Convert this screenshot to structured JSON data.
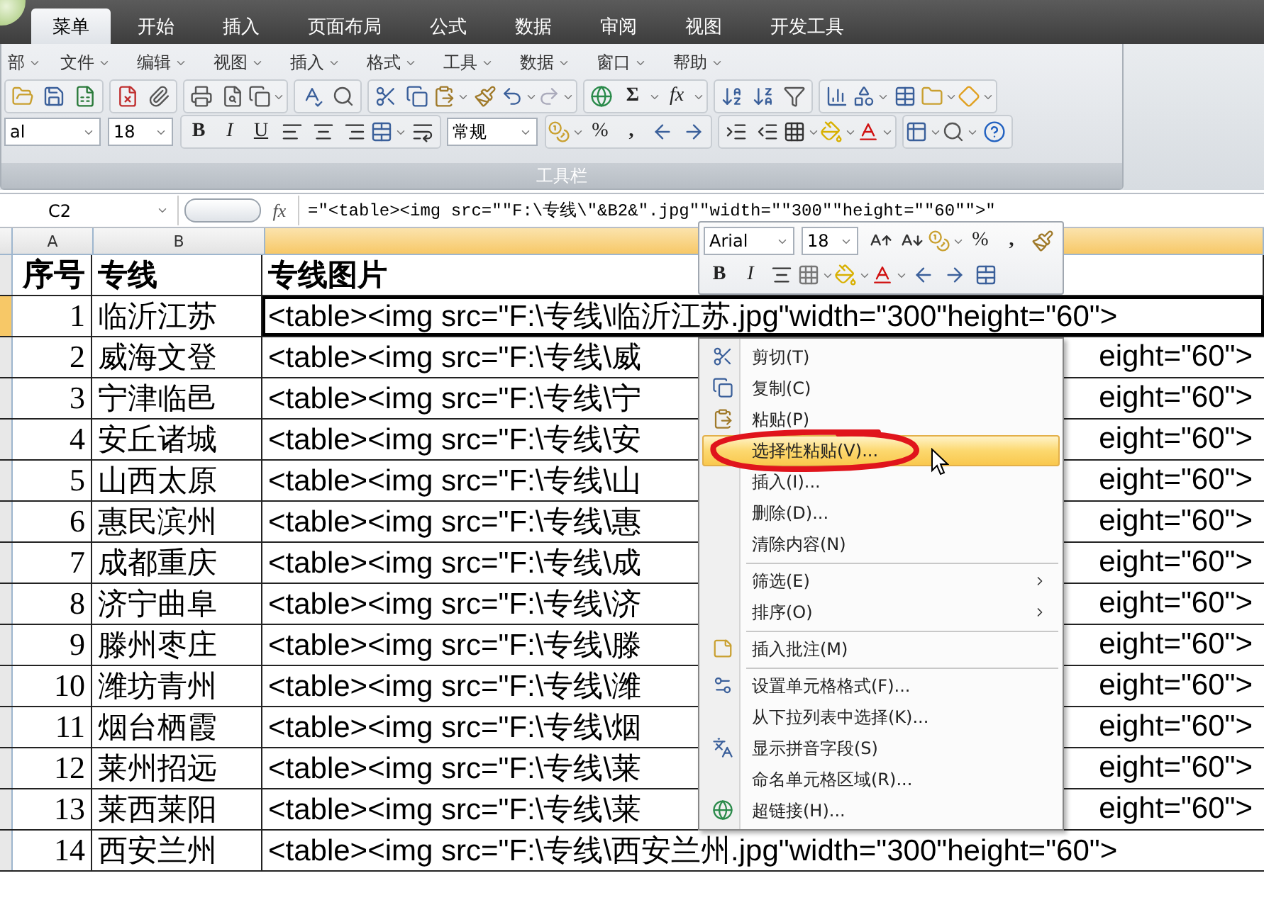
{
  "tabs": [
    {
      "label": "菜单",
      "selected": true
    },
    {
      "label": "开始",
      "selected": false
    },
    {
      "label": "插入",
      "selected": false
    },
    {
      "label": "页面布局",
      "selected": false
    },
    {
      "label": "公式",
      "selected": false
    },
    {
      "label": "数据",
      "selected": false
    },
    {
      "label": "审阅",
      "selected": false
    },
    {
      "label": "视图",
      "selected": false
    },
    {
      "label": "开发工具",
      "selected": false
    }
  ],
  "menu_bar": [
    "部",
    "文件",
    "编辑",
    "视图",
    "插入",
    "格式",
    "工具",
    "数据",
    "窗口",
    "帮助"
  ],
  "toolbar": {
    "sum": "Σ",
    "function": "fx",
    "font": "al",
    "size": "18",
    "bold": "B",
    "italic": "I",
    "underline": "U",
    "number_format": "常规",
    "percent": "%",
    "comma": ","
  },
  "group_label": "工具栏",
  "formula_bar": {
    "name_box": "C2",
    "fx": "fx",
    "formula": "=\"<table><img src=\"\"F:\\专线\\\"&B2&\".jpg\"\"width=\"\"300\"\"height=\"\"60\"\">\""
  },
  "column_headers": [
    {
      "label": "A",
      "selected": false
    },
    {
      "label": "B",
      "selected": false
    },
    {
      "selected": true
    }
  ],
  "header_row": [
    "序号",
    "专线",
    "专线图片"
  ],
  "rows": [
    {
      "no": "1",
      "line": "临沂江苏",
      "image": "<table><img src=\"F:\\专线\\临沂江苏.jpg\"width=\"300\"height=\"60\">",
      "selected": true
    },
    {
      "no": "2",
      "line": "威海文登",
      "image": "<table><img src=\"F:\\专线\\威",
      "image_right": "eight=\"60\">",
      "selected": false
    },
    {
      "no": "3",
      "line": "宁津临邑",
      "image": "<table><img src=\"F:\\专线\\宁",
      "image_right": "eight=\"60\">",
      "selected": false
    },
    {
      "no": "4",
      "line": "安丘诸城",
      "image": "<table><img src=\"F:\\专线\\安",
      "image_right": "eight=\"60\">",
      "selected": false
    },
    {
      "no": "5",
      "line": "山西太原",
      "image": "<table><img src=\"F:\\专线\\山",
      "image_right": "eight=\"60\">",
      "selected": false
    },
    {
      "no": "6",
      "line": "惠民滨州",
      "image": "<table><img src=\"F:\\专线\\惠",
      "image_right": "eight=\"60\">",
      "selected": false
    },
    {
      "no": "7",
      "line": "成都重庆",
      "image": "<table><img src=\"F:\\专线\\成",
      "image_right": "eight=\"60\">",
      "selected": false
    },
    {
      "no": "8",
      "line": "济宁曲阜",
      "image": "<table><img src=\"F:\\专线\\济",
      "image_right": "eight=\"60\">",
      "selected": false
    },
    {
      "no": "9",
      "line": "滕州枣庄",
      "image": "<table><img src=\"F:\\专线\\滕",
      "image_right": "eight=\"60\">",
      "selected": false
    },
    {
      "no": "10",
      "line": "潍坊青州",
      "image": "<table><img src=\"F:\\专线\\潍",
      "image_right": "eight=\"60\">",
      "selected": false
    },
    {
      "no": "11",
      "line": "烟台栖霞",
      "image": "<table><img src=\"F:\\专线\\烟",
      "image_right": "eight=\"60\">",
      "selected": false
    },
    {
      "no": "12",
      "line": "莱州招远",
      "image": "<table><img src=\"F:\\专线\\莱",
      "image_right": "eight=\"60\">",
      "selected": false
    },
    {
      "no": "13",
      "line": "莱西莱阳",
      "image": "<table><img src=\"F:\\专线\\莱",
      "image_right": "eight=\"60\">",
      "selected": false
    },
    {
      "no": "14",
      "line": "西安兰州",
      "image": "<table><img src=\"F:\\专线\\西安兰州.jpg\"width=\"300\"height=\"60\">",
      "selected": false
    }
  ],
  "mini_toolbar": {
    "font": "Arial",
    "size": "18",
    "percent": "%",
    "comma": ",",
    "bold": "B",
    "italic": "I"
  },
  "context_menu": {
    "items": [
      {
        "label": "剪切(T)",
        "selected": false,
        "has_submenu": false,
        "separator_before": false
      },
      {
        "label": "复制(C)",
        "selected": false,
        "has_submenu": false,
        "separator_before": false
      },
      {
        "label": "粘贴(P)",
        "selected": false,
        "has_submenu": false,
        "separator_before": false
      },
      {
        "label": "选择性粘贴(V)...",
        "selected": true,
        "has_submenu": false,
        "separator_before": false
      },
      {
        "label": "插入(I)...",
        "selected": false,
        "has_submenu": false,
        "separator_before": false
      },
      {
        "label": "删除(D)...",
        "selected": false,
        "has_submenu": false,
        "separator_before": false
      },
      {
        "label": "清除内容(N)",
        "selected": false,
        "has_submenu": false,
        "separator_before": false
      },
      {
        "label": "筛选(E)",
        "selected": false,
        "has_submenu": true,
        "separator_before": true
      },
      {
        "label": "排序(O)",
        "selected": false,
        "has_submenu": true,
        "separator_before": false
      },
      {
        "label": "插入批注(M)",
        "selected": false,
        "has_submenu": false,
        "separator_before": true
      },
      {
        "label": "设置单元格格式(F)...",
        "selected": false,
        "has_submenu": false,
        "separator_before": true
      },
      {
        "label": "从下拉列表中选择(K)...",
        "selected": false,
        "has_submenu": false,
        "separator_before": false
      },
      {
        "label": "显示拼音字段(S)",
        "selected": false,
        "has_submenu": false,
        "separator_before": false
      },
      {
        "label": "命名单元格区域(R)...",
        "selected": false,
        "has_submenu": false,
        "separator_before": false
      },
      {
        "label": "超链接(H)...",
        "selected": false,
        "has_submenu": false,
        "separator_before": false
      }
    ]
  }
}
